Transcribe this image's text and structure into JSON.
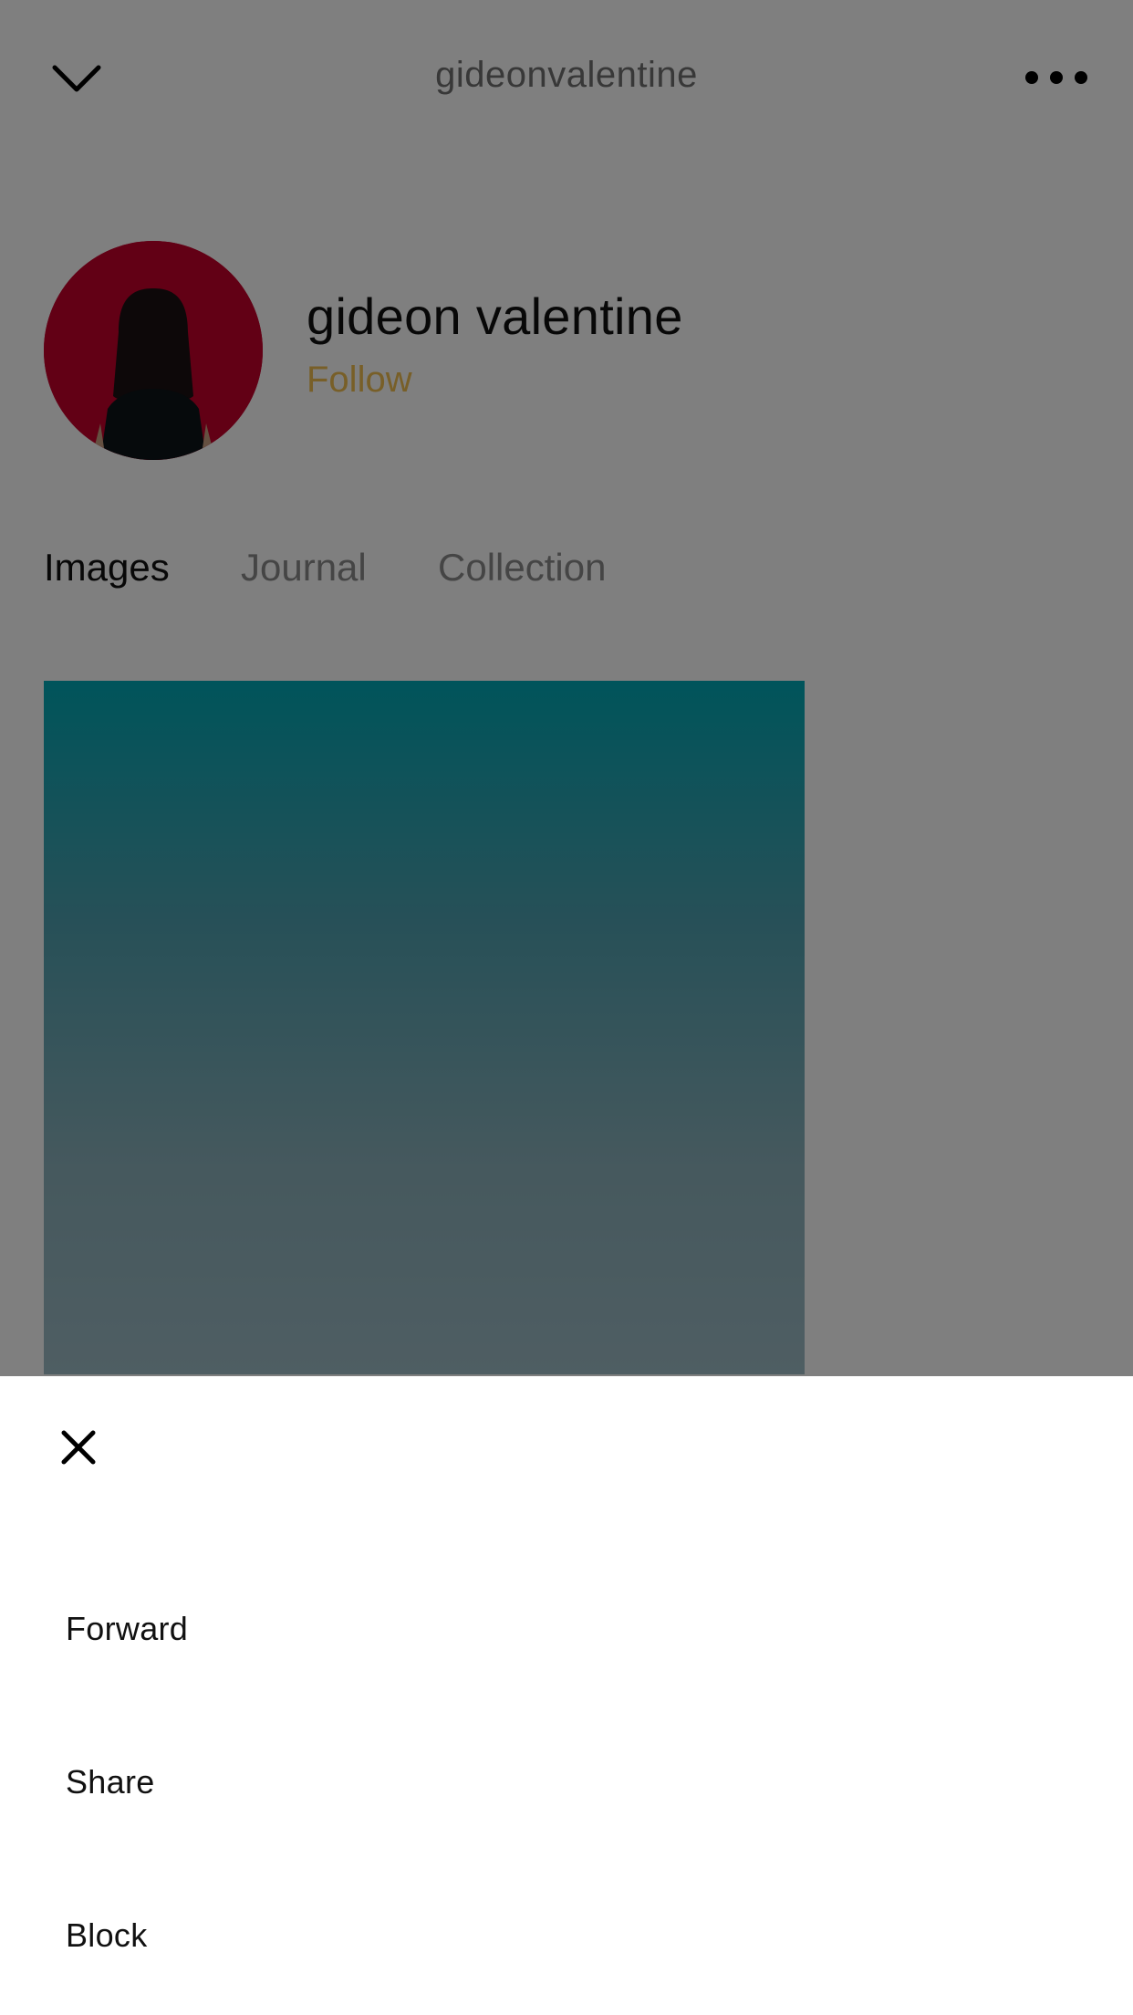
{
  "header": {
    "title": "gideonvalentine",
    "back_icon": "chevron-down-icon",
    "more_icon": "more-horizontal-icon"
  },
  "profile": {
    "name": "gideon valentine",
    "follow_label": "Follow",
    "avatar_bg": "#c4002a",
    "follow_color": "#f0be50"
  },
  "tabs": [
    {
      "label": "Images",
      "active": true
    },
    {
      "label": "Journal",
      "active": false
    },
    {
      "label": "Collection",
      "active": false
    }
  ],
  "sheet": {
    "close_icon": "close-icon",
    "items": [
      {
        "label": "Forward"
      },
      {
        "label": "Share"
      },
      {
        "label": "Block"
      }
    ]
  }
}
